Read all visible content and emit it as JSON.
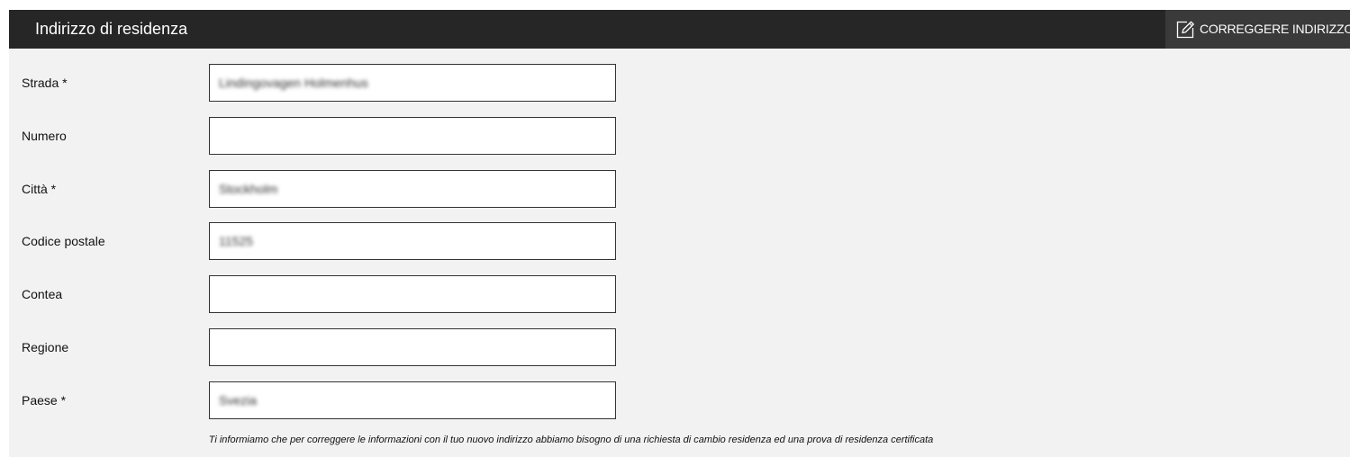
{
  "header": {
    "title": "Indirizzo di residenza",
    "edit_button_label": "CORREGGERE INDIRIZZO",
    "edit_icon": "edit-icon"
  },
  "fields": [
    {
      "label": "Strada *",
      "value": "Lindingovagen Holmenhus"
    },
    {
      "label": "Numero",
      "value": ""
    },
    {
      "label": "Città *",
      "value": "Stockholm"
    },
    {
      "label": "Codice postale",
      "value": "11525"
    },
    {
      "label": "Contea",
      "value": ""
    },
    {
      "label": "Regione",
      "value": ""
    },
    {
      "label": "Paese *",
      "value": "Svezia"
    }
  ],
  "notice": "Ti informiamo che per correggere le informazioni con il tuo nuovo indirizzo abbiamo bisogno di una richiesta di cambio residenza ed una prova di residenza certificata",
  "colors": {
    "header_bg": "#262626",
    "button_bg": "#3a3a3a",
    "panel_bg": "#f2f2f2"
  }
}
